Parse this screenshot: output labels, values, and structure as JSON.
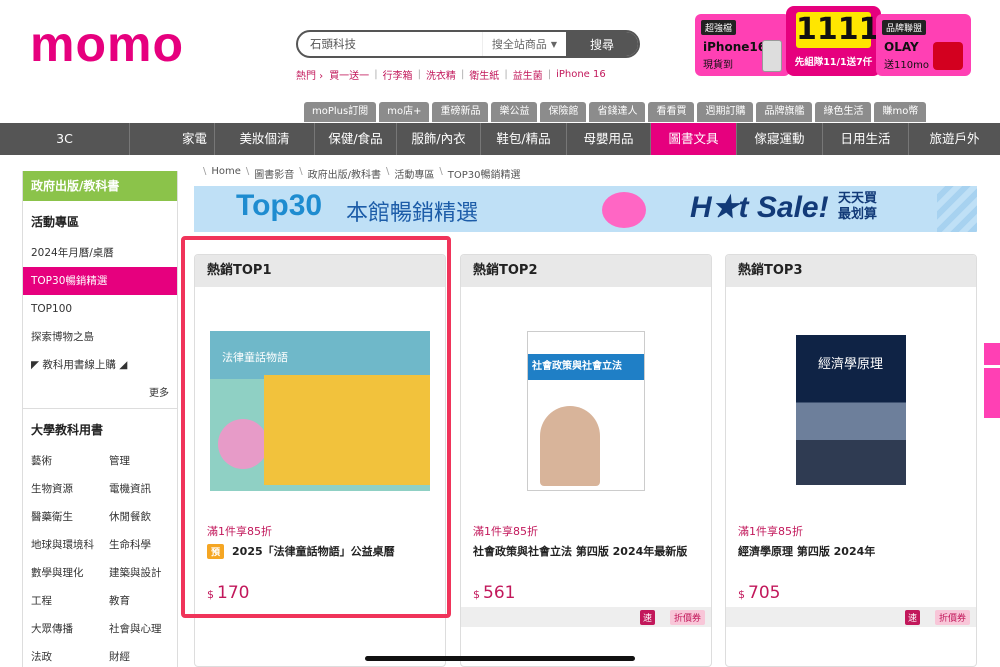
{
  "header": {
    "logo": "momo",
    "search": {
      "value": "石頭科技",
      "scope": "搜全站商品",
      "button": "搜尋"
    },
    "hot": {
      "label": "熱門 ›",
      "links": [
        "買一送一",
        "行李箱",
        "洗衣精",
        "衛生紙",
        "益生菌",
        "iPhone 16"
      ]
    },
    "promos": [
      {
        "tag": "超強檔",
        "title": "iPhone16",
        "sub": "現貨到"
      },
      {
        "big": "1111",
        "sub": "先組隊11/1送7仟"
      },
      {
        "tag": "品牌聯盟",
        "title": "OLAY",
        "sub": "送110mo"
      }
    ]
  },
  "subtabs": [
    "moPlus訂閱",
    "mo店+",
    "重磅新品",
    "樂公益",
    "保險館",
    "省錢達人",
    "看看買",
    "週期訂購",
    "品牌旗艦",
    "綠色生活",
    "賺mo幣"
  ],
  "mainnav": {
    "items": [
      "3C",
      "家電",
      "美妝個清",
      "保健/食品",
      "服飾/內衣",
      "鞋包/精品",
      "母嬰用品",
      "圖書文具",
      "傢寢運動",
      "日用生活",
      "旅遊戶外"
    ],
    "active_index": 7
  },
  "sidebar": {
    "header": "政府出版/教科書",
    "group1": "活動專區",
    "items": [
      "2024年月曆/桌曆",
      "TOP30暢銷精選",
      "TOP100",
      "探索博物之島",
      "◤ 教科用書線上購 ◢"
    ],
    "active": "TOP30暢銷精選",
    "more": "更多",
    "group2": "大學教科用書",
    "grid": [
      "藝術",
      "管理",
      "生物資源",
      "電機資訊",
      "醫藥衛生",
      "休閒餐飲",
      "地球與環境科",
      "生命科學",
      "數學與理化",
      "建築與設計",
      "工程",
      "教育",
      "大眾傳播",
      "社會與心理",
      "法政",
      "財經"
    ]
  },
  "breadcrumb": [
    "Home",
    "圖書影音",
    "政府出版/教科書",
    "活動專區",
    "TOP30暢銷精選"
  ],
  "banner": {
    "top30": "Top30",
    "subtitle": "本館暢銷精選",
    "hot": "H★t Sale!",
    "brand_line1": "天天買",
    "brand_line2": "最划算"
  },
  "products": [
    {
      "rank": "熱銷TOP1",
      "promo": "滿1件享85折",
      "badge": "預",
      "name": "2025「法律童話物語」公益桌曆",
      "currency": "$",
      "price": "170",
      "cover_title": "法律童話物語"
    },
    {
      "rank": "熱銷TOP2",
      "promo": "滿1件享85折",
      "name": "社會政策與社會立法 第四版 2024年最新版",
      "currency": "$",
      "price": "561",
      "cover_title": "社會政策與社會立法",
      "fast": "速",
      "coupon": "折價券"
    },
    {
      "rank": "熱銷TOP3",
      "promo": "滿1件享85折",
      "name": "經濟學原理 第四版 2024年",
      "currency": "$",
      "price": "705",
      "cover_title": "經濟學原理",
      "fast": "速",
      "coupon": "折價券"
    }
  ],
  "colors": {
    "brand": "#e6007e",
    "nav": "#555555",
    "sidebar_head": "#8bc34a",
    "highlight": "#f0345a"
  }
}
